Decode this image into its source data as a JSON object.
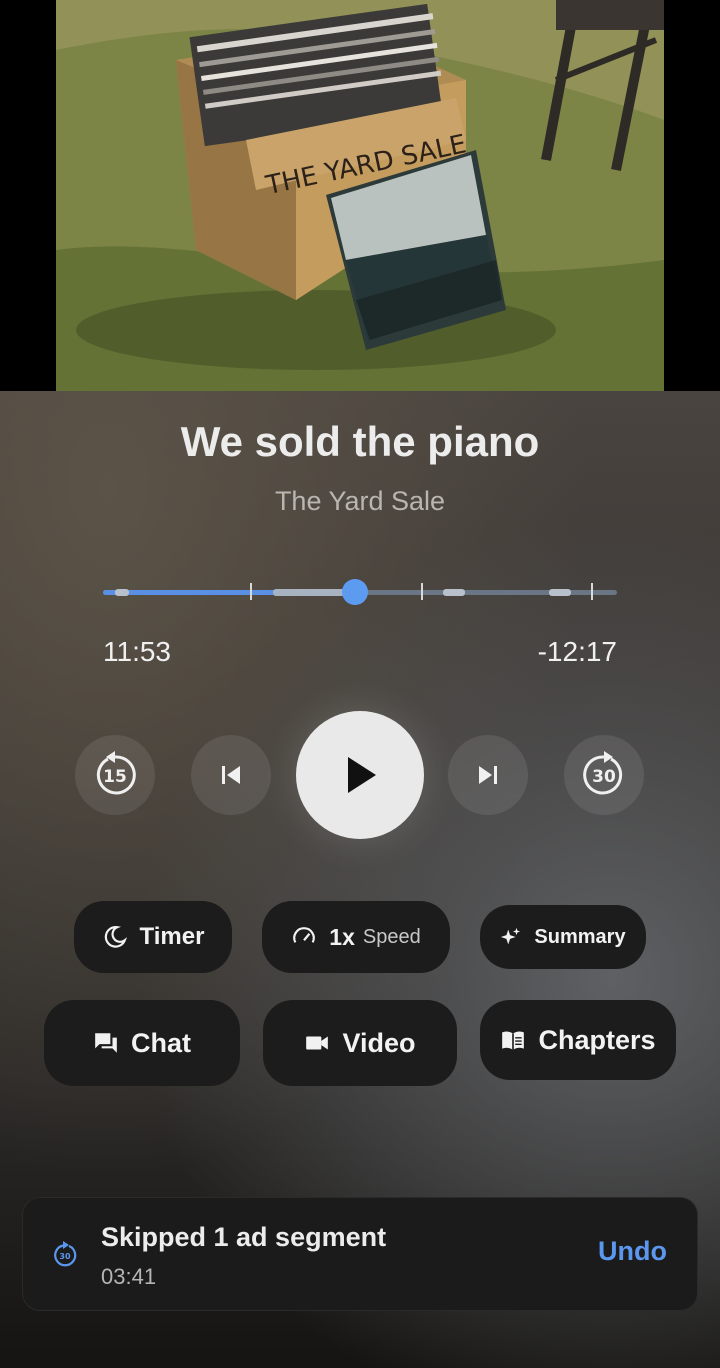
{
  "episode": {
    "title": "We sold the piano",
    "podcast": "The Yard Sale",
    "artwork_text": "THE YARD SALE"
  },
  "playback": {
    "elapsed": "11:53",
    "remaining": "-12:17",
    "progress_fraction": 0.49,
    "skip_back_seconds": "15",
    "skip_forward_seconds": "30",
    "accent_color": "#5d9bf0"
  },
  "actions": {
    "timer_label": "Timer",
    "speed_value": "1x",
    "speed_label": "Speed",
    "summary_label": "Summary",
    "chat_label": "Chat",
    "video_label": "Video",
    "chapters_label": "Chapters"
  },
  "toast": {
    "message": "Skipped 1 ad segment",
    "time": "03:41",
    "undo_label": "Undo",
    "icon": "skip-30-icon"
  }
}
